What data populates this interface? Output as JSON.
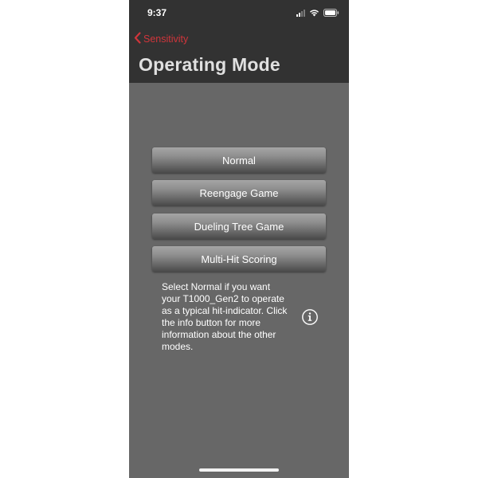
{
  "status_bar": {
    "time": "9:37"
  },
  "nav": {
    "back_label": "Sensitivity",
    "title": "Operating Mode"
  },
  "modes": [
    {
      "label": "Normal"
    },
    {
      "label": "Reengage Game"
    },
    {
      "label": "Dueling Tree Game"
    },
    {
      "label": "Multi-Hit Scoring"
    }
  ],
  "description": "Select Normal if you want\nyour T1000_Gen2 to operate\nas a typical hit-indicator. Click\nthe info button for more\ninformation about the other\nmodes.",
  "icons": {
    "back": "chevron-left-icon",
    "info": "info-circle-icon",
    "signal": "cellular-signal-icon",
    "wifi": "wifi-icon",
    "battery": "battery-icon"
  },
  "colors": {
    "accent": "#d0353b",
    "header_bg": "#323232",
    "content_bg": "#676767"
  }
}
